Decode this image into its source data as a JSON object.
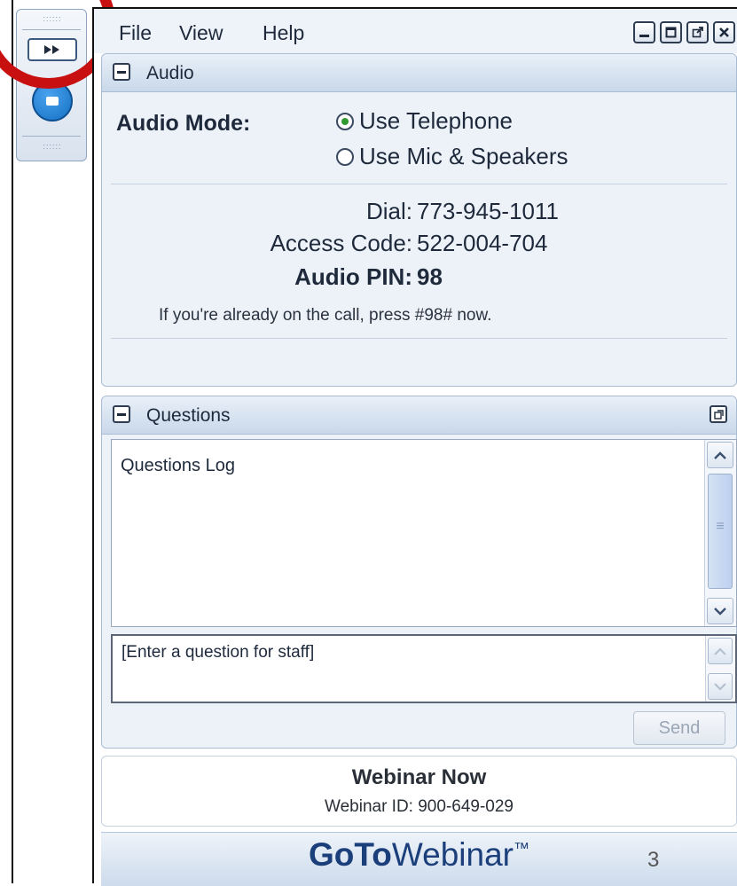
{
  "menu": {
    "file": "File",
    "view": "View",
    "help": "Help"
  },
  "window_buttons": [
    "minimize-icon",
    "maximize-icon",
    "popout-icon",
    "close-icon"
  ],
  "audio": {
    "title": "Audio",
    "mode_label": "Audio Mode:",
    "options": [
      {
        "label": "Use Telephone",
        "selected": true
      },
      {
        "label": "Use Mic & Speakers",
        "selected": false
      }
    ],
    "dial_label": "Dial:",
    "dial_value": "773-945-1011",
    "access_label": "Access Code:",
    "access_value": "522-004-704",
    "pin_label": "Audio PIN:",
    "pin_value": "98",
    "note": "If you're already on the call, press #98# now."
  },
  "questions": {
    "title": "Questions",
    "log_text": "Questions Log",
    "placeholder": "[Enter a question for staff]",
    "send_label": "Send"
  },
  "webinar": {
    "title": "Webinar Now",
    "id_text": "Webinar ID: 900-649-029"
  },
  "brand": {
    "go": "GoTo",
    "rest": "Webinar",
    "tm": "™"
  },
  "slide_number": "3",
  "colors": {
    "highlight_ring": "#c81010",
    "brand": "#1b3f7a",
    "radio_selected": "#2f9b2f"
  }
}
